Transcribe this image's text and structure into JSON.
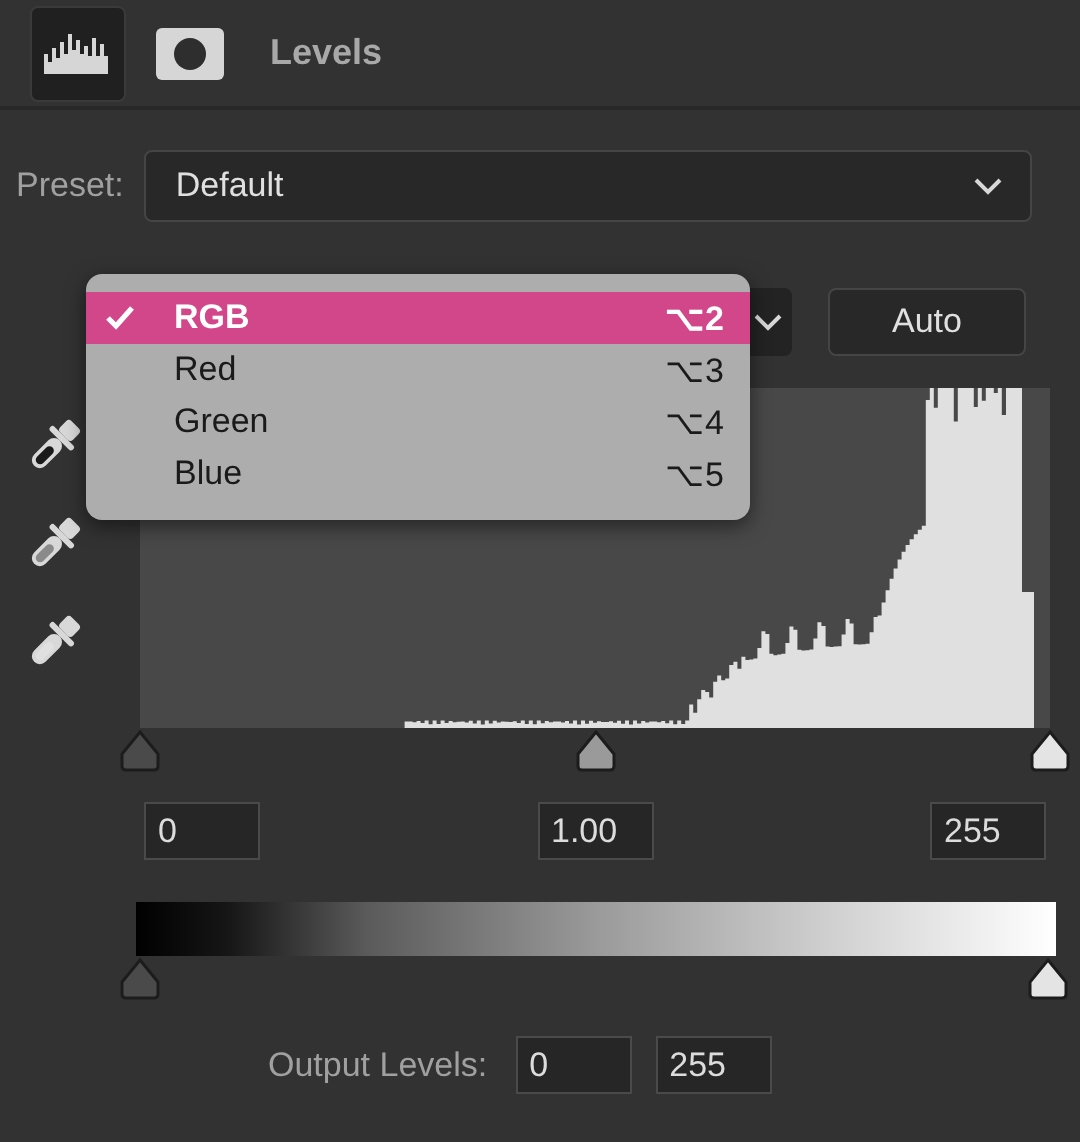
{
  "property_tabs": [
    {
      "kind": "histogram",
      "selected": true
    },
    {
      "kind": "mask",
      "selected": false
    }
  ],
  "title": "Levels",
  "preset": {
    "label": "Preset:",
    "value": "Default"
  },
  "auto_button": "Auto",
  "channel_menu": {
    "items": [
      {
        "label": "RGB",
        "shortcut": "⌥2",
        "selected": true
      },
      {
        "label": "Red",
        "shortcut": "⌥3",
        "selected": false
      },
      {
        "label": "Green",
        "shortcut": "⌥4",
        "selected": false
      },
      {
        "label": "Blue",
        "shortcut": "⌥5",
        "selected": false
      }
    ]
  },
  "eyedroppers": [
    {
      "kind": "black"
    },
    {
      "kind": "gray"
    },
    {
      "kind": "white"
    }
  ],
  "input_levels": {
    "sliders": [
      {
        "kind": "shadow"
      },
      {
        "kind": "midtone"
      },
      {
        "kind": "highlight"
      }
    ],
    "fields": [
      "0",
      "1.00",
      "255"
    ]
  },
  "output_levels": {
    "label": "Output Levels:",
    "fields": [
      "0",
      "255"
    ]
  }
}
